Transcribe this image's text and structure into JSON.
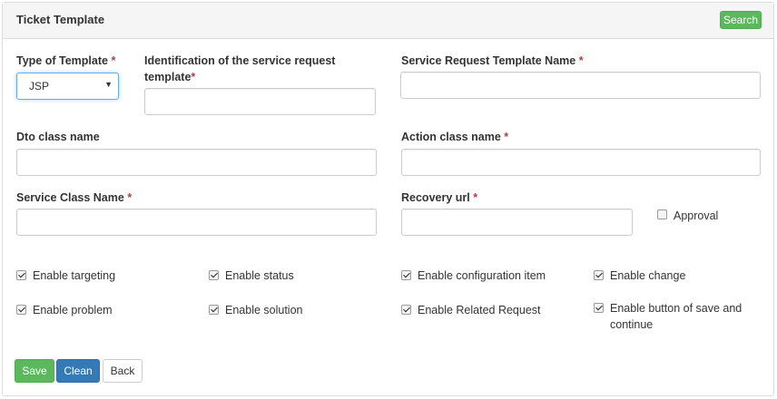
{
  "panel": {
    "title": "Ticket Template",
    "search_label": "Search"
  },
  "fields": {
    "type_of_template": {
      "label": "Type of Template",
      "required_mark": "*",
      "value": "JSP"
    },
    "identification": {
      "label_line1": "Identification of the service request",
      "label_line2": "template",
      "required_mark": "*",
      "value": ""
    },
    "service_request_template_name": {
      "label": "Service Request Template Name",
      "required_mark": "*",
      "value": ""
    },
    "dto_class_name": {
      "label": "Dto class name",
      "value": ""
    },
    "action_class_name": {
      "label": "Action class name",
      "required_mark": "*",
      "value": ""
    },
    "service_class_name": {
      "label": "Service Class Name",
      "required_mark": "*",
      "value": ""
    },
    "recovery_url": {
      "label": "Recovery url",
      "required_mark": "*",
      "value": ""
    }
  },
  "approval": {
    "label": "Approval",
    "checked": false
  },
  "options": [
    {
      "label": "Enable targeting",
      "checked": true
    },
    {
      "label": "Enable status",
      "checked": true
    },
    {
      "label": "Enable configuration item",
      "checked": true
    },
    {
      "label": "Enable change",
      "checked": true
    },
    {
      "label": "Enable problem",
      "checked": true
    },
    {
      "label": "Enable solution",
      "checked": true
    },
    {
      "label": "Enable Related Request",
      "checked": true
    },
    {
      "label_line1": "Enable button of save and",
      "label_line2": "continue",
      "checked": true
    }
  ],
  "actions": {
    "save_label": "Save",
    "clean_label": "Clean",
    "back_label": "Back"
  },
  "colors": {
    "success": "#5cb85c",
    "primary": "#337ab7",
    "required": "#a94442"
  }
}
